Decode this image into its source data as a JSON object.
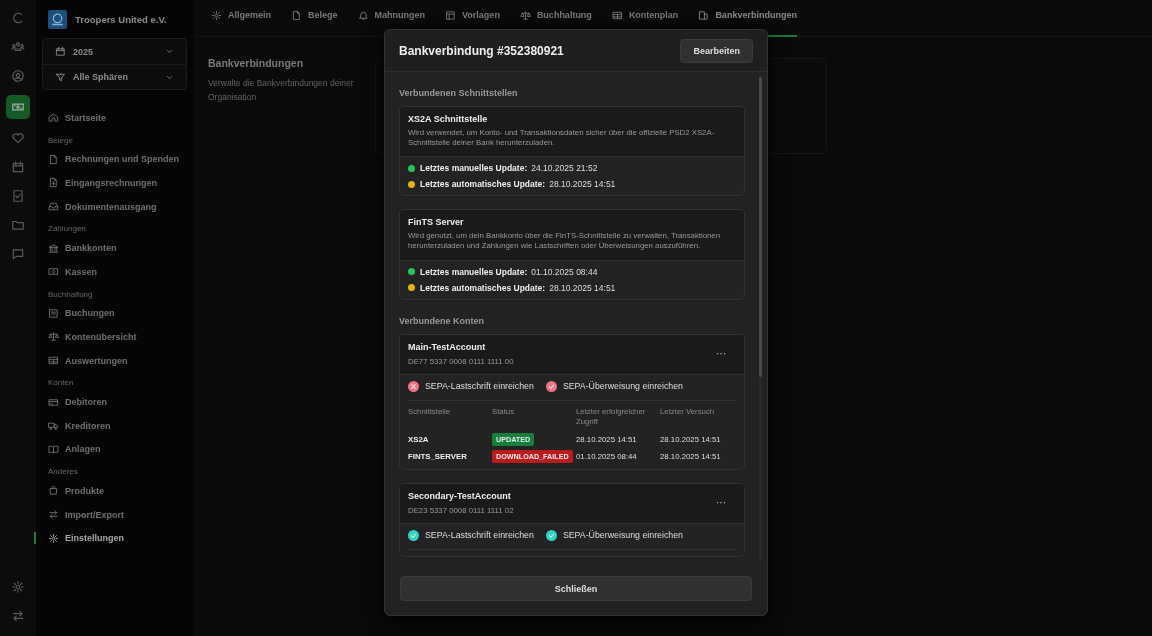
{
  "rail": {
    "top": [
      {
        "kind": "logo",
        "selected": false
      },
      {
        "kind": "people",
        "selected": false
      },
      {
        "kind": "user",
        "selected": false
      },
      {
        "kind": "money",
        "selected": true
      },
      {
        "kind": "heart",
        "selected": false
      },
      {
        "kind": "calendar",
        "selected": false
      },
      {
        "kind": "checkdoc",
        "selected": false
      },
      {
        "kind": "folder",
        "selected": false
      },
      {
        "kind": "chat",
        "selected": false
      }
    ],
    "bottom": [
      {
        "kind": "gear",
        "selected": false
      },
      {
        "kind": "arrows",
        "selected": false
      }
    ]
  },
  "sidebar": {
    "org_name": "Troopers United e.V.",
    "year": "2025",
    "sphere": "Alle Sphären",
    "groups": [
      {
        "items": [
          {
            "kind": "home",
            "label": "Startseite",
            "selected": false
          }
        ]
      },
      {
        "heading": "Belege",
        "items": [
          {
            "kind": "file",
            "label": "Rechnungen und Spenden",
            "selected": false
          },
          {
            "kind": "filedown",
            "label": "Eingangsrechnungen",
            "selected": false
          },
          {
            "kind": "inbox",
            "label": "Dokumentenausgang",
            "selected": false
          }
        ]
      },
      {
        "heading": "Zahlungen",
        "items": [
          {
            "kind": "bank",
            "label": "Bankkonten",
            "selected": false
          },
          {
            "kind": "cash",
            "label": "Kassen",
            "selected": false
          }
        ]
      },
      {
        "heading": "Buchhaltung",
        "items": [
          {
            "kind": "ledger",
            "label": "Buchungen",
            "selected": false
          },
          {
            "kind": "scale",
            "label": "Kontenübersicht",
            "selected": false
          },
          {
            "kind": "table",
            "label": "Auswertungen",
            "selected": false
          }
        ]
      },
      {
        "heading": "Konten",
        "items": [
          {
            "kind": "card",
            "label": "Debitoren",
            "selected": false
          },
          {
            "kind": "truck",
            "label": "Kreditoren",
            "selected": false
          },
          {
            "kind": "book",
            "label": "Anlagen",
            "selected": false
          }
        ]
      },
      {
        "heading": "Anderes",
        "items": [
          {
            "kind": "bag",
            "label": "Produkte",
            "selected": false
          },
          {
            "kind": "arrows",
            "label": "Import/Export",
            "selected": false
          },
          {
            "kind": "gear",
            "label": "Einstellungen",
            "selected": true
          }
        ]
      }
    ]
  },
  "tabs": [
    {
      "kind": "gear",
      "label": "Allgemein",
      "selected": false
    },
    {
      "kind": "file",
      "label": "Belege",
      "selected": false
    },
    {
      "kind": "bell",
      "label": "Mahnungen",
      "selected": false
    },
    {
      "kind": "template",
      "label": "Vorlagen",
      "selected": false
    },
    {
      "kind": "scale",
      "label": "Buchhaltung",
      "selected": false
    },
    {
      "kind": "table",
      "label": "Kontenplan",
      "selected": false
    },
    {
      "kind": "bankconn",
      "label": "Bankverbindungen",
      "selected": true
    }
  ],
  "page": {
    "title": "Bankverbindungen",
    "description": "Verwalte die Bankverbindungen deiner Organisation"
  },
  "modal": {
    "title": "Bankverbindung #352380921",
    "edit_button": "Bearbeiten",
    "interfaces_heading": "Verbundenen Schnittstellen",
    "interfaces": [
      {
        "name": "XS2A Schnittstelle",
        "description": "Wird verwendet, um Konto- und Transaktionsdaten sicher über die offizielle PSD2 XS2A-Schnittstelle deiner Bank herunterzuladen.",
        "updates": [
          {
            "label": "Letztes manuelles Update:",
            "value": "24.10.2025 21:52",
            "color": "#22c55e"
          },
          {
            "label": "Letztes automatisches Update:",
            "value": "28.10.2025 14:51",
            "color": "#eab308"
          }
        ]
      },
      {
        "name": "FinTS Server",
        "description": "Wird genutzt, um dein Bankkonto über die FinTS-Schnittstelle zu verwalten, Transaktionen herunterzuladen und Zahlungen wie Lastschriften oder Überweisungen auszuführen.",
        "updates": [
          {
            "label": "Letztes manuelles Update:",
            "value": "01.10.2025 08:44",
            "color": "#22c55e"
          },
          {
            "label": "Letztes automatisches Update:",
            "value": "28.10.2025 14:51",
            "color": "#eab308"
          }
        ]
      }
    ],
    "accounts_heading": "Verbundene Konten",
    "accounts": [
      {
        "name": "Main-TestAccount",
        "iban": "DE77 5337 0008 0111 1111 00",
        "menu": "···",
        "permissions": [
          {
            "kind": "cross",
            "label": "SEPA-Lastschrift einreichen",
            "color": "#f0717f"
          },
          {
            "kind": "check",
            "label": "SEPA-Überweisung einreichen",
            "color": "#f0717f"
          }
        ],
        "columns": [
          "Schnittstelle",
          "Status",
          "Letzter erfolgreicher Zugriff",
          "Letzter Versuch"
        ],
        "rows": [
          {
            "interface": "XS2A",
            "status": "UPDATED",
            "color": "#15803d",
            "last_success": "28.10.2025 14:51",
            "last_attempt": "28.10.2025 14:51"
          },
          {
            "interface": "FINTS_SERVER",
            "status": "DOWNLOAD_FAILED",
            "color": "#b91c1c",
            "last_success": "01.10.2025 08:44",
            "last_attempt": "28.10.2025 14:51"
          }
        ]
      },
      {
        "name": "Secondary-TestAccount",
        "iban": "DE23 5337 0008 0111 1111 02",
        "menu": "···",
        "permissions": [
          {
            "kind": "check",
            "label": "SEPA-Lastschrift einreichen",
            "color": "#2dd4bf"
          },
          {
            "kind": "check",
            "label": "SEPA-Überweisung einreichen",
            "color": "#2dd4bf"
          }
        ]
      }
    ],
    "close_button": "Schließen"
  }
}
